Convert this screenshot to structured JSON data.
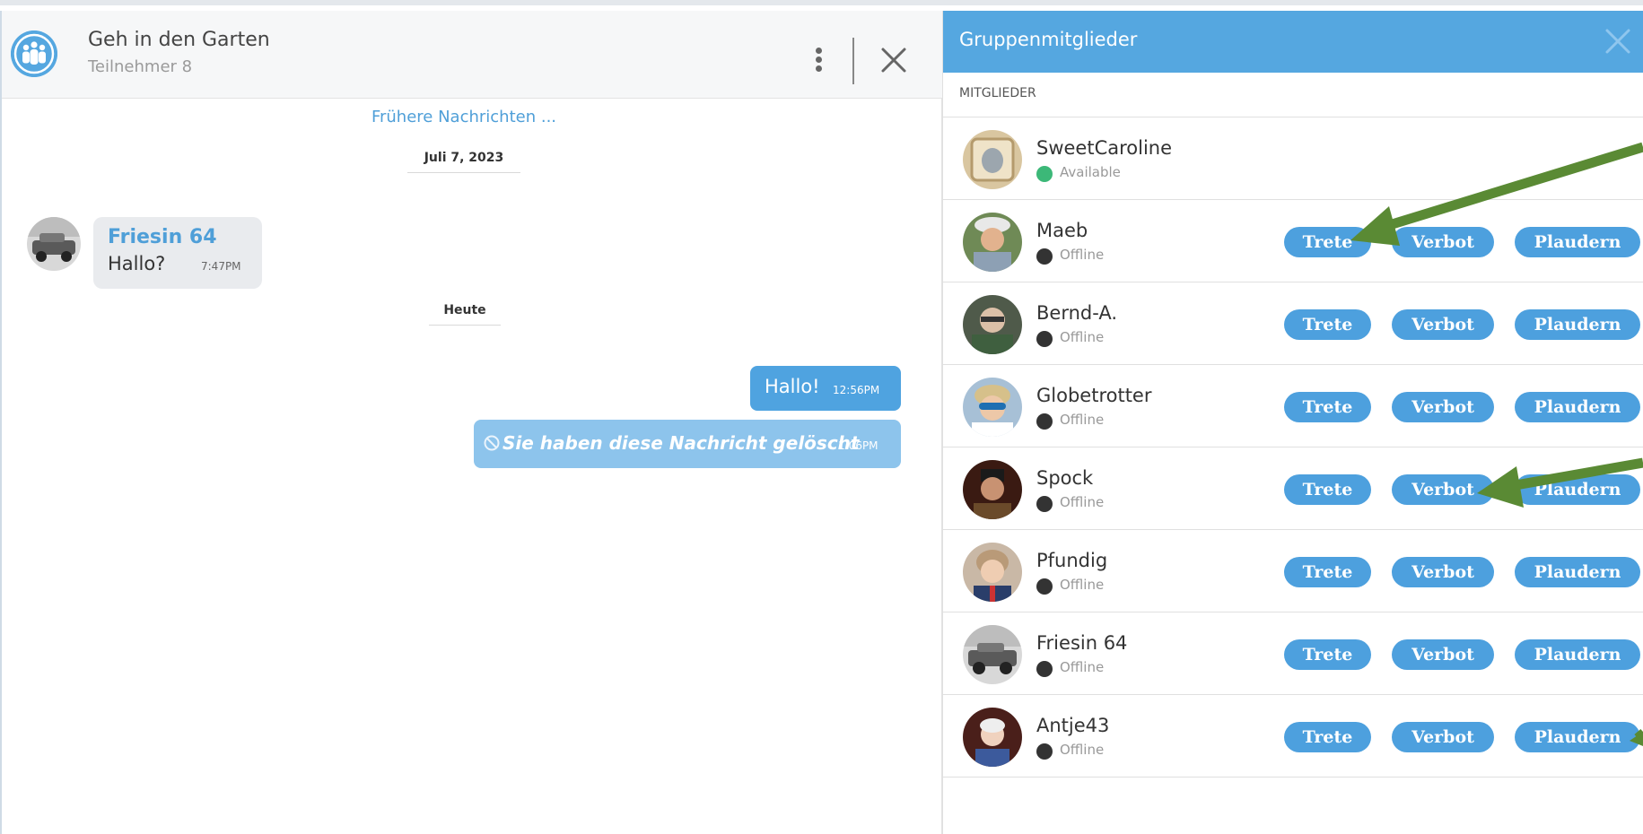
{
  "chat": {
    "title": "Geh in den Garten",
    "subtitle": "Teilnehmer 8",
    "earlier_link": "Frühere Nachrichten ...",
    "date_1": "Juli 7, 2023",
    "date_2": "Heute",
    "messages": [
      {
        "sender": "Friesin 64",
        "text": "Hallo?",
        "time": "7:47PM",
        "direction": "incoming"
      },
      {
        "text": "Hallo!",
        "time": "12:56PM",
        "direction": "outgoing"
      },
      {
        "text": "Sie haben diese Nachricht gelöscht",
        "time": "1:06PM",
        "direction": "outgoing",
        "deleted": true
      }
    ]
  },
  "members_panel": {
    "title": "Gruppenmitglieder",
    "section_label": "MITGLIEDER",
    "buttons": {
      "kick": "Trete",
      "ban": "Verbot",
      "chat": "Plaudern"
    },
    "members": [
      {
        "name": "SweetCaroline",
        "status": "Available",
        "online": true
      },
      {
        "name": "Maeb",
        "status": "Offline",
        "online": false
      },
      {
        "name": "Bernd-A.",
        "status": "Offline",
        "online": false
      },
      {
        "name": "Globetrotter",
        "status": "Offline",
        "online": false
      },
      {
        "name": "Spock",
        "status": "Offline",
        "online": false
      },
      {
        "name": "Pfundig",
        "status": "Offline",
        "online": false
      },
      {
        "name": "Friesin 64",
        "status": "Offline",
        "online": false
      },
      {
        "name": "Antje43",
        "status": "Offline",
        "online": false
      }
    ]
  },
  "colors": {
    "accent": "#4da0de",
    "header_blue": "#55a7e0",
    "online": "#3cb878",
    "annotation_arrow": "#5a8a34"
  },
  "icons": [
    "group-icon",
    "more-vertical-icon",
    "close-icon",
    "ban-icon"
  ]
}
